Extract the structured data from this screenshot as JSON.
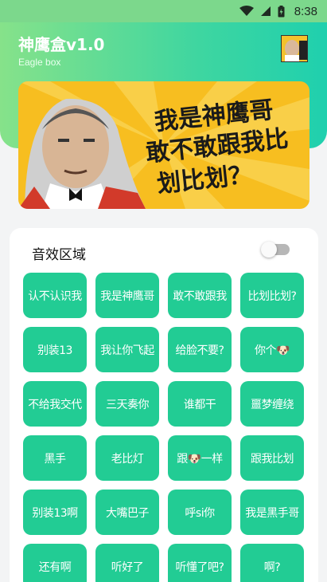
{
  "status_bar": {
    "time": "8:38"
  },
  "header": {
    "title": "神鹰盒v1.0",
    "subtitle": "Eagle box"
  },
  "banner": {
    "line1": "我是神鹰哥",
    "line2": "敢不敢跟我比",
    "line3": "划比划？"
  },
  "section": {
    "title": "音效区域",
    "toggle_on": false
  },
  "buttons": [
    "认不认识我",
    "我是神鹰哥",
    "敢不敢跟我",
    "比划比划?",
    "别装13",
    "我让你飞起",
    "给脸不要?",
    "你个🐶",
    "不给我交代",
    "三天奏你",
    "谁都干",
    "噩梦缠绕",
    "黑手",
    "老比灯",
    "跟🐶一样",
    "跟我比划",
    "别装13啊",
    "大嘴巴子",
    "呼si你",
    "我是黑手哥",
    "还有啊",
    "听好了",
    "听懂了吧?",
    "啊?"
  ],
  "colors": {
    "accent": "#22cc94",
    "header_gradient_start": "#86e28a",
    "header_gradient_end": "#1fd0ae",
    "banner_bg": "#f7be20"
  },
  "icons": [
    "wifi-icon",
    "signal-icon",
    "battery-icon"
  ]
}
